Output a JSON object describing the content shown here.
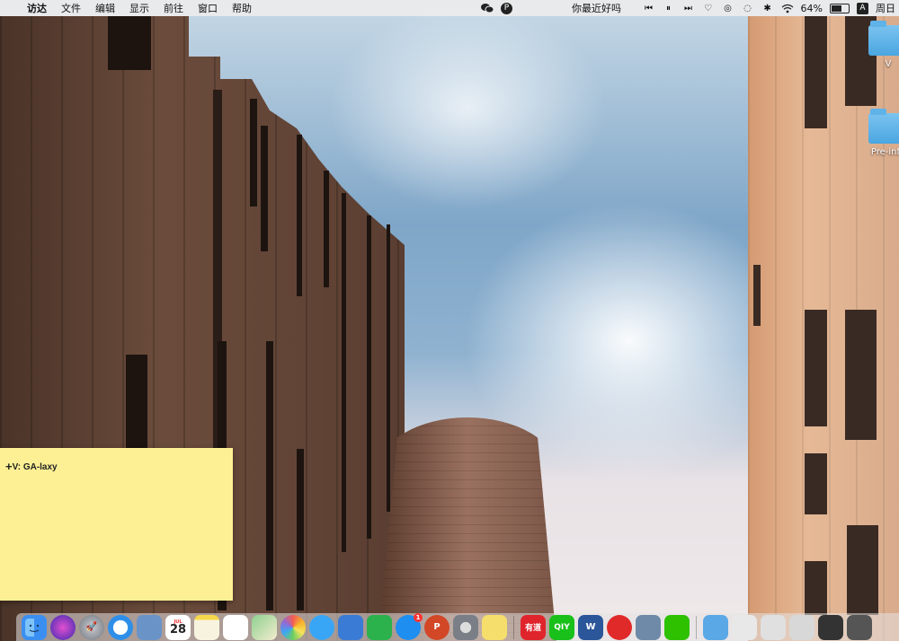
{
  "menubar": {
    "app_name": "访达",
    "menus": [
      "文件",
      "编辑",
      "显示",
      "前往",
      "窗口",
      "帮助"
    ],
    "center_icon_letter": "P",
    "now_playing": "你最近好吗",
    "battery": "64%",
    "input_method": "A",
    "clock": "周日"
  },
  "desktop": {
    "icons": [
      {
        "label": "V"
      },
      {
        "label": "Pre-info"
      }
    ]
  },
  "sticky": {
    "text": "V: GA-laxy"
  },
  "dock": {
    "calendar_day": "28",
    "youdao_label": "有道",
    "iqiyi_label": "QIY",
    "word_label": "W",
    "ppt_label": "P",
    "appstore_badge": "1",
    "items": [
      {
        "name": "finder",
        "color": "#3b8ff0"
      },
      {
        "name": "siri",
        "color": "#6b4bd8"
      },
      {
        "name": "launchpad",
        "color": "#8a8f99"
      },
      {
        "name": "safari",
        "color": "#2f8fe8"
      },
      {
        "name": "preview",
        "color": "#6a94c8"
      },
      {
        "name": "calendar",
        "color": "#ffffff"
      },
      {
        "name": "notes",
        "color": "#f7f3df"
      },
      {
        "name": "reminders",
        "color": "#ffffff"
      },
      {
        "name": "maps",
        "color": "#6bbf6b"
      },
      {
        "name": "photos",
        "color": "#f3f3f3"
      },
      {
        "name": "messages",
        "color": "#39a6f5"
      },
      {
        "name": "keynote",
        "color": "#3a7bd5"
      },
      {
        "name": "numbers",
        "color": "#2bb24c"
      },
      {
        "name": "app-store",
        "color": "#1e8ef0"
      },
      {
        "name": "powerpoint",
        "color": "#d24726"
      },
      {
        "name": "system-preferences",
        "color": "#7a7f87"
      },
      {
        "name": "stickies",
        "color": "#f5de6b"
      },
      {
        "name": "youdao",
        "color": "#e0242c"
      },
      {
        "name": "iqiyi",
        "color": "#19c019"
      },
      {
        "name": "word",
        "color": "#2b579a"
      },
      {
        "name": "netease-music",
        "color": "#e02a2a"
      },
      {
        "name": "image-viewer",
        "color": "#6f8aa8"
      },
      {
        "name": "wechat",
        "color": "#2dc100"
      },
      {
        "name": "downloads-folder",
        "color": "#5aa8e6"
      },
      {
        "name": "doc-stack-1",
        "color": "#e8e8e8"
      },
      {
        "name": "doc-stack-2",
        "color": "#e0e0e0"
      },
      {
        "name": "doc-stack-3",
        "color": "#d8d8d8"
      },
      {
        "name": "doc-stack-4",
        "color": "#333333"
      },
      {
        "name": "doc-stack-5",
        "color": "#555555"
      }
    ]
  }
}
